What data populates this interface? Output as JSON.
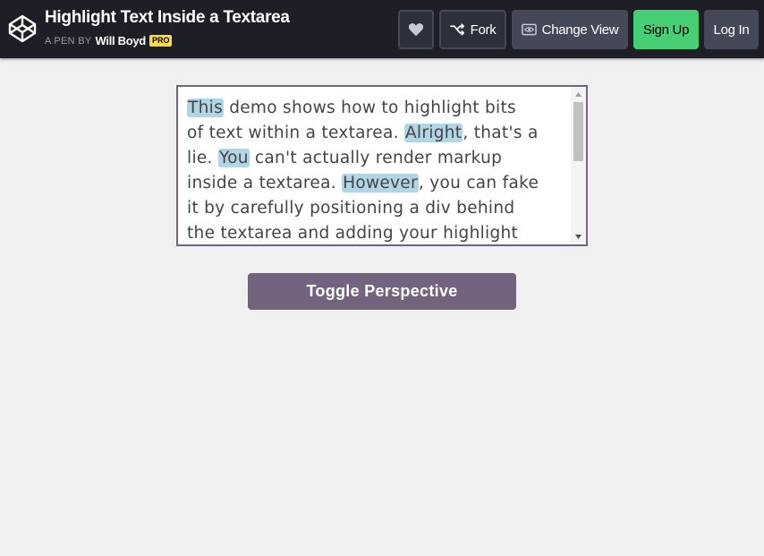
{
  "header": {
    "pen_title": "Highlight Text Inside a Textarea",
    "byline_prefix": "A PEN BY",
    "author": "Will Boyd",
    "pro_badge": "PRO",
    "buttons": {
      "fork": "Fork",
      "change_view": "Change View",
      "sign_up": "Sign Up",
      "log_in": "Log In"
    },
    "icons": {
      "logo": "codepen-logo-icon",
      "heart": "heart-icon",
      "fork": "fork-icon",
      "change_view": "eye-icon"
    }
  },
  "editor": {
    "lines": [
      [
        {
          "t": "This",
          "h": true
        },
        {
          "t": " demo shows how to highlight bits",
          "h": false
        }
      ],
      [
        {
          "t": "of text within a textarea. ",
          "h": false
        },
        {
          "t": "Alright",
          "h": true
        },
        {
          "t": ", that's a",
          "h": false
        }
      ],
      [
        {
          "t": "lie. ",
          "h": false
        },
        {
          "t": "You",
          "h": true
        },
        {
          "t": " can't actually render markup",
          "h": false
        }
      ],
      [
        {
          "t": "inside a textarea. ",
          "h": false
        },
        {
          "t": "However",
          "h": true
        },
        {
          "t": ", you can fake",
          "h": false
        }
      ],
      [
        {
          "t": "it by carefully positioning a div behind",
          "h": false
        }
      ],
      [
        {
          "t": "the textarea and adding your highlight",
          "h": false
        }
      ]
    ],
    "highlight_color": "#b1d5e5",
    "border_color": "#74637f"
  },
  "toggle_button": {
    "label": "Toggle Perspective",
    "color": "#74637f"
  },
  "colors": {
    "header_bg": "#1e1f26",
    "signup_green": "#47cf73",
    "pro_yellow": "#ffdd40",
    "page_bg": "#f0f0f0"
  }
}
